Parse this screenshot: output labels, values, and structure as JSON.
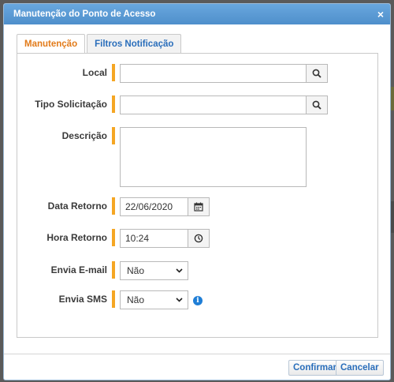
{
  "dialog": {
    "title": "Manutenção do Ponto de Acesso",
    "close_glyph": "×"
  },
  "tabs": [
    {
      "label": "Manutenção",
      "active": true
    },
    {
      "label": "Filtros Notificação",
      "active": false
    }
  ],
  "form": {
    "local": {
      "label": "Local",
      "value": "",
      "icon": "search-icon"
    },
    "tipo": {
      "label": "Tipo Solicitação",
      "value": "",
      "icon": "search-icon"
    },
    "descricao": {
      "label": "Descrição",
      "value": ""
    },
    "data_retorno": {
      "label": "Data Retorno",
      "value": "22/06/2020",
      "icon": "calendar-icon"
    },
    "hora_retorno": {
      "label": "Hora Retorno",
      "value": "10:24",
      "icon": "clock-icon"
    },
    "envia_email": {
      "label": "Envia E-mail",
      "value": "Não"
    },
    "envia_sms": {
      "label": "Envia SMS",
      "value": "Não",
      "info_glyph": "i"
    }
  },
  "footer": {
    "confirm_label": "Confirmar",
    "cancel_label": "Cancelar"
  },
  "colors": {
    "title_bar": "#5b9bd5",
    "required_marker": "#f5a623",
    "active_tab": "#e27b1a",
    "link_blue": "#2a6ebb"
  }
}
